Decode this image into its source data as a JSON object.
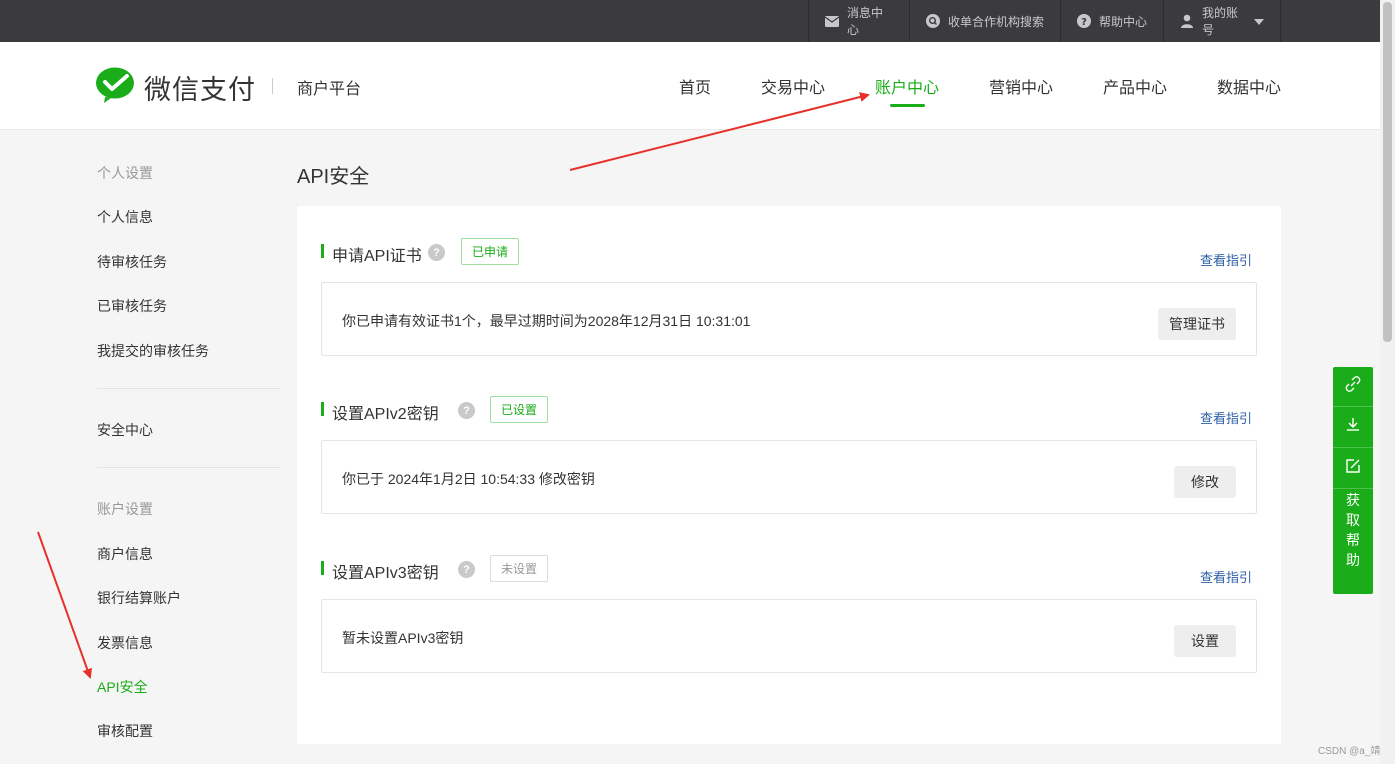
{
  "topbar": {
    "items": [
      {
        "label": "消息中心",
        "icon": "mail-icon"
      },
      {
        "label": "收单合作机构搜索",
        "icon": "search-circle-icon"
      },
      {
        "label": "帮助中心",
        "icon": "question-icon"
      },
      {
        "label": "我的账号",
        "icon": "user-icon"
      }
    ]
  },
  "header": {
    "logo_text": "微信支付",
    "platform": "商户平台",
    "nav": [
      "首页",
      "交易中心",
      "账户中心",
      "营销中心",
      "产品中心",
      "数据中心"
    ],
    "active_nav": "账户中心"
  },
  "sidebar": {
    "group1_title": "个人设置",
    "group1_items": [
      "个人信息",
      "待审核任务",
      "已审核任务",
      "我提交的审核任务"
    ],
    "security_center": "安全中心",
    "group2_title": "账户设置",
    "group2_items": [
      "商户信息",
      "银行结算账户",
      "发票信息",
      "API安全",
      "审核配置"
    ],
    "active_item": "API安全"
  },
  "main": {
    "page_title": "API安全",
    "sections": [
      {
        "title": "申请API证书",
        "badge": "已申请",
        "guide": "查看指引",
        "text": "你已申请有效证书1个，最早过期时间为2028年12月31日 10:31:01",
        "button": "管理证书"
      },
      {
        "title": "设置APIv2密钥",
        "badge": "已设置",
        "guide": "查看指引",
        "text": "你已于 2024年1月2日 10:54:33 修改密钥",
        "button": "修改"
      },
      {
        "title": "设置APIv3密钥",
        "badge": "未设置",
        "guide": "查看指引",
        "text": "暂未设置APIv3密钥",
        "button": "设置"
      }
    ]
  },
  "float_toolbar": {
    "icons": [
      "link-icon",
      "download-icon",
      "edit-icon"
    ],
    "help_chars": [
      "获",
      "取",
      "帮",
      "助"
    ]
  },
  "watermark": "CSDN @a_靖",
  "colors": {
    "brand_green": "#1aad19",
    "topbar_bg": "#3b3b3f",
    "link_blue": "#2d5fa6",
    "annotation_red": "#e8302a"
  }
}
